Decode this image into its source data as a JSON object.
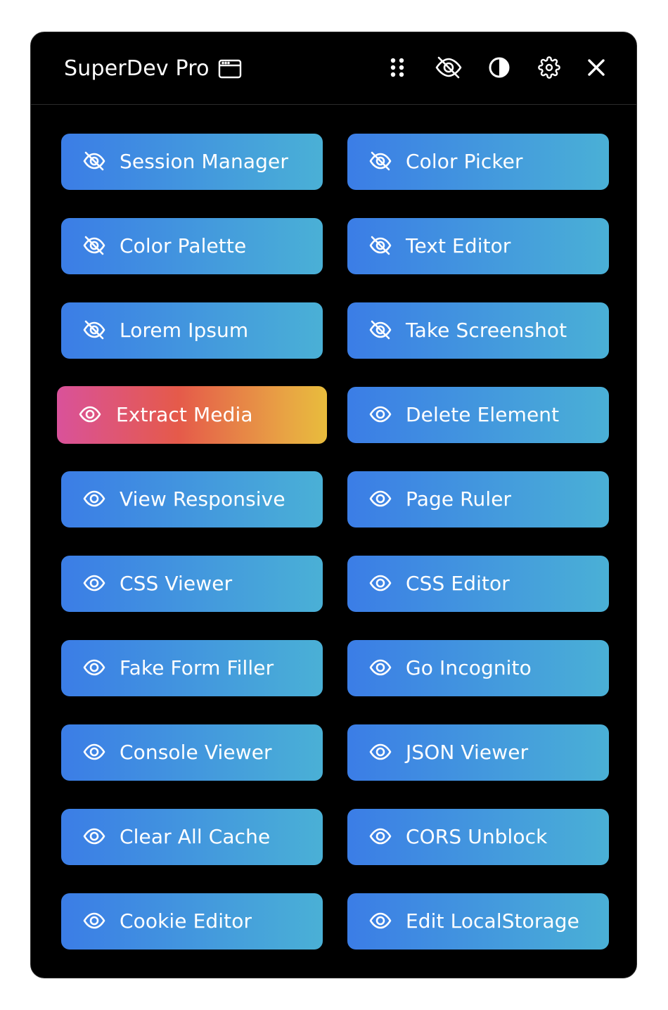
{
  "header": {
    "title": "SuperDev Pro",
    "icons": [
      "window-icon",
      "grid-dots-icon",
      "eye-off-icon",
      "contrast-icon",
      "gear-icon",
      "close-icon"
    ]
  },
  "colors": {
    "panel_bg": "#000000",
    "button_gradient_start": "#3b7de6",
    "button_gradient_end": "#4ab0d6",
    "active_gradient": [
      "#d9529a",
      "#e55a4a",
      "#e8bc3c"
    ],
    "text": "#ffffff"
  },
  "tools": [
    {
      "label": "Session Manager",
      "icon": "eye-off-icon",
      "active": false
    },
    {
      "label": "Color Picker",
      "icon": "eye-off-icon",
      "active": false
    },
    {
      "label": "Color Palette",
      "icon": "eye-off-icon",
      "active": false
    },
    {
      "label": "Text Editor",
      "icon": "eye-off-icon",
      "active": false
    },
    {
      "label": "Lorem Ipsum",
      "icon": "eye-off-icon",
      "active": false
    },
    {
      "label": "Take Screenshot",
      "icon": "eye-off-icon",
      "active": false
    },
    {
      "label": "Extract Media",
      "icon": "eye-icon",
      "active": true
    },
    {
      "label": "Delete Element",
      "icon": "eye-icon",
      "active": false
    },
    {
      "label": "View Responsive",
      "icon": "eye-icon",
      "active": false
    },
    {
      "label": "Page Ruler",
      "icon": "eye-icon",
      "active": false
    },
    {
      "label": "CSS Viewer",
      "icon": "eye-icon",
      "active": false
    },
    {
      "label": "CSS Editor",
      "icon": "eye-icon",
      "active": false
    },
    {
      "label": "Fake Form Filler",
      "icon": "eye-icon",
      "active": false
    },
    {
      "label": "Go Incognito",
      "icon": "eye-icon",
      "active": false
    },
    {
      "label": "Console Viewer",
      "icon": "eye-icon",
      "active": false
    },
    {
      "label": "JSON Viewer",
      "icon": "eye-icon",
      "active": false
    },
    {
      "label": "Clear All Cache",
      "icon": "eye-icon",
      "active": false
    },
    {
      "label": "CORS Unblock",
      "icon": "eye-icon",
      "active": false
    },
    {
      "label": "Cookie Editor",
      "icon": "eye-icon",
      "active": false
    },
    {
      "label": "Edit LocalStorage",
      "icon": "eye-icon",
      "active": false
    }
  ]
}
